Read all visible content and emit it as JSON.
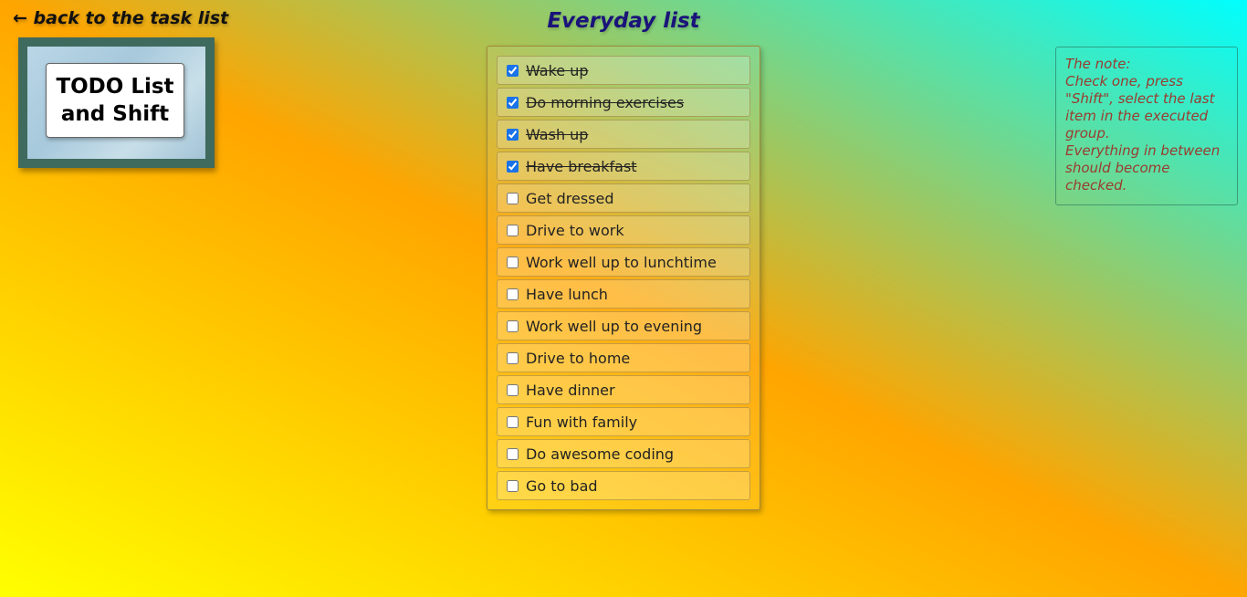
{
  "back_link": "← back to the task list",
  "logo": {
    "line1": "TODO List",
    "line2": "and Shift"
  },
  "title": "Everyday list",
  "tasks": [
    {
      "label": "Wake up",
      "checked": true
    },
    {
      "label": "Do morning exercises",
      "checked": true
    },
    {
      "label": "Wash up",
      "checked": true
    },
    {
      "label": "Have breakfast",
      "checked": true
    },
    {
      "label": "Get dressed",
      "checked": false
    },
    {
      "label": "Drive to work",
      "checked": false
    },
    {
      "label": "Work well up to lunchtime",
      "checked": false
    },
    {
      "label": "Have lunch",
      "checked": false
    },
    {
      "label": "Work well up to evening",
      "checked": false
    },
    {
      "label": "Drive to home",
      "checked": false
    },
    {
      "label": "Have dinner",
      "checked": false
    },
    {
      "label": "Fun with family",
      "checked": false
    },
    {
      "label": "Do awesome coding",
      "checked": false
    },
    {
      "label": "Go to bad",
      "checked": false
    }
  ],
  "note": {
    "heading": "The note:",
    "text": "Check one, press \"Shift\", select the last item in the executed group.",
    "text2": "Everything in between should become checked."
  },
  "colors": {
    "gradient_start": "#ffff00",
    "gradient_mid": "#ffa500",
    "gradient_end": "#00ffff",
    "title": "#1a137a",
    "note_text": "#9a3b2f",
    "logo_frame": "#3f6a5e"
  }
}
